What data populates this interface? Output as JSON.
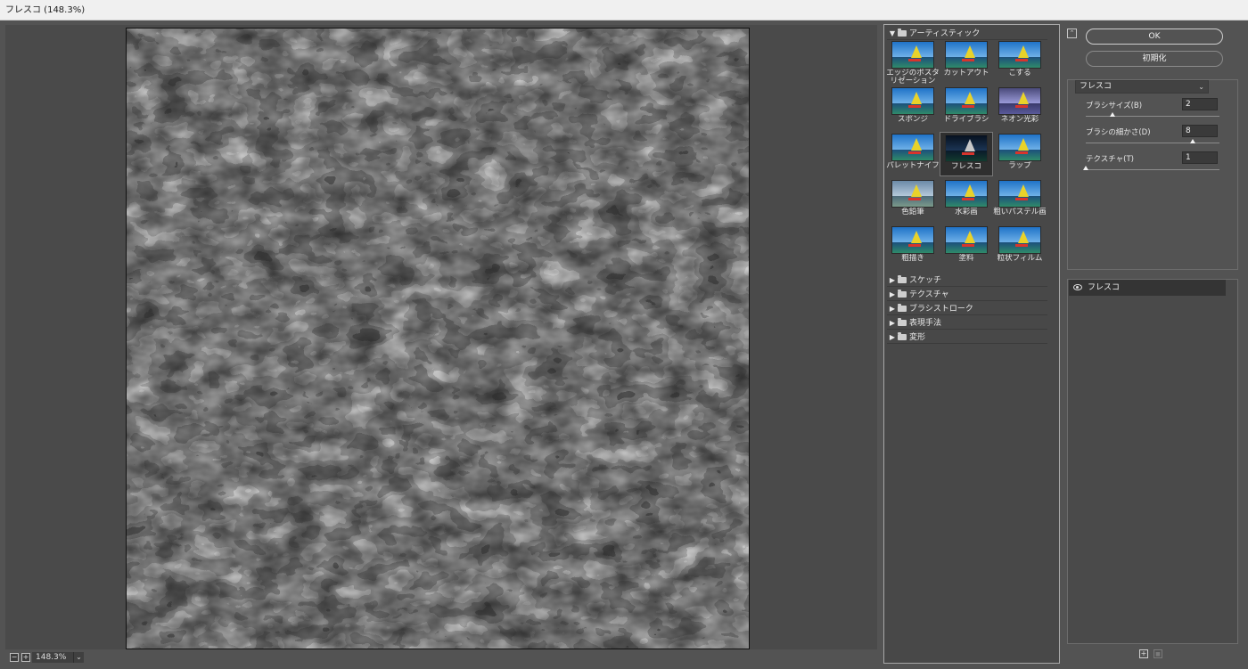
{
  "window": {
    "title": "フレスコ (148.3%)"
  },
  "zoom": {
    "value": "148.3%",
    "minus": "−",
    "plus": "+",
    "dropdown": "⌄"
  },
  "gallery": {
    "expanded_category": "アーティスティック",
    "filters": [
      {
        "label": "エッジのポスタリゼーション",
        "style": "normal"
      },
      {
        "label": "カットアウト",
        "style": "normal"
      },
      {
        "label": "こする",
        "style": "normal"
      },
      {
        "label": "スポンジ",
        "style": "normal"
      },
      {
        "label": "ドライブラシ",
        "style": "normal"
      },
      {
        "label": "ネオン光彩",
        "style": "neon"
      },
      {
        "label": "パレットナイフ",
        "style": "normal"
      },
      {
        "label": "フレスコ",
        "style": "dark",
        "selected": true
      },
      {
        "label": "ラップ",
        "style": "normal"
      },
      {
        "label": "色鉛筆",
        "style": "gray"
      },
      {
        "label": "水彩画",
        "style": "normal"
      },
      {
        "label": "粗いパステル画",
        "style": "normal"
      },
      {
        "label": "粗描き",
        "style": "normal"
      },
      {
        "label": "塗料",
        "style": "normal"
      },
      {
        "label": "粒状フィルム",
        "style": "normal"
      }
    ],
    "collapsed_categories": [
      "スケッチ",
      "テクスチャ",
      "ブラシストローク",
      "表現手法",
      "変形"
    ]
  },
  "panel": {
    "ok_label": "OK",
    "reset_label": "初期化",
    "collapse_glyph": "⌃",
    "filter_select": "フレスコ",
    "params": [
      {
        "label": "ブラシサイズ(B)",
        "value": "2",
        "level": 0.2
      },
      {
        "label": "ブラシの細かさ(D)",
        "value": "8",
        "level": 0.8
      },
      {
        "label": "テクスチャ(T)",
        "value": "1",
        "level": 0.0
      }
    ]
  },
  "layers": {
    "items": [
      {
        "name": "フレスコ",
        "visible": true
      }
    ],
    "new_layer": "+",
    "delete_layer": "🗑"
  },
  "colors": {
    "background": "#535353",
    "accent_bg": "#343434",
    "border": "#a8a8a8"
  }
}
